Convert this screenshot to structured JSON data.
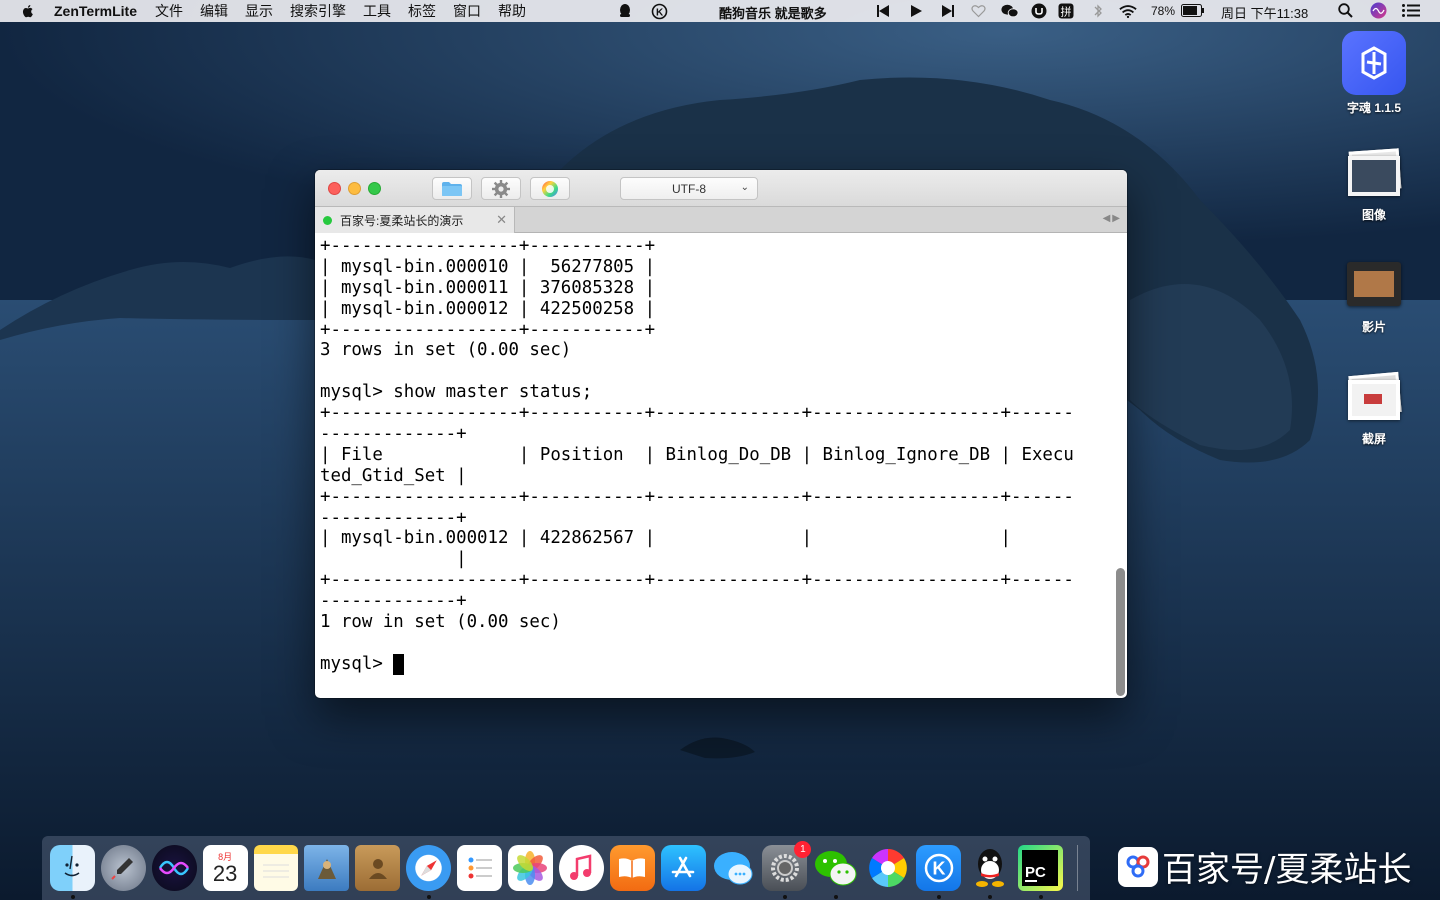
{
  "menubar": {
    "app_name": "ZenTermLite",
    "menus": [
      "文件",
      "编辑",
      "显示",
      "搜索引擎",
      "工具",
      "标签",
      "窗口",
      "帮助"
    ],
    "music_title": "酷狗音乐  就是歌多",
    "battery": "78%",
    "clock": "周日 下午11:38"
  },
  "desktop": {
    "icons": [
      {
        "label": "字魂 1.1.5",
        "icon": "font-app-icon"
      },
      {
        "label": "图像",
        "icon": "image-folder-icon"
      },
      {
        "label": "影片",
        "icon": "movie-folder-icon"
      },
      {
        "label": "截屏",
        "icon": "screenshot-folder-icon"
      }
    ]
  },
  "window": {
    "encoding": "UTF-8",
    "tab_title": "百家号:夏柔站长的演示",
    "terminal_lines": [
      "+------------------+-----------+",
      "| mysql-bin.000010 |  56277805 |",
      "| mysql-bin.000011 | 376085328 |",
      "| mysql-bin.000012 | 422500258 |",
      "+------------------+-----------+",
      "3 rows in set (0.00 sec)",
      "",
      "mysql> show master status;",
      "+------------------+-----------+--------------+------------------+------",
      "-------------+",
      "| File             | Position  | Binlog_Do_DB | Binlog_Ignore_DB | Execu",
      "ted_Gtid_Set |",
      "+------------------+-----------+--------------+------------------+------",
      "-------------+",
      "| mysql-bin.000012 | 422862567 |              |                  |",
      "             |",
      "+------------------+-----------+--------------+------------------+------",
      "-------------+",
      "1 row in set (0.00 sec)",
      "",
      "mysql> "
    ]
  },
  "dock": {
    "apps": [
      "finder-icon",
      "launchpad-icon",
      "siri-icon",
      "calendar-icon",
      "notes-icon",
      "preview-icon",
      "contacts-icon",
      "safari-icon",
      "reminders-icon",
      "photos-icon",
      "music-icon",
      "books-icon",
      "app-store-icon",
      "messages-icon",
      "system-preferences-icon",
      "wechat-icon",
      "color-app-icon",
      "kugou-icon",
      "qq-icon",
      "pycharm-icon"
    ],
    "calendar_month": "8月",
    "calendar_day": "23",
    "sysprefs_badge": "1"
  },
  "watermark": {
    "text": "百家号/夏柔站长"
  }
}
